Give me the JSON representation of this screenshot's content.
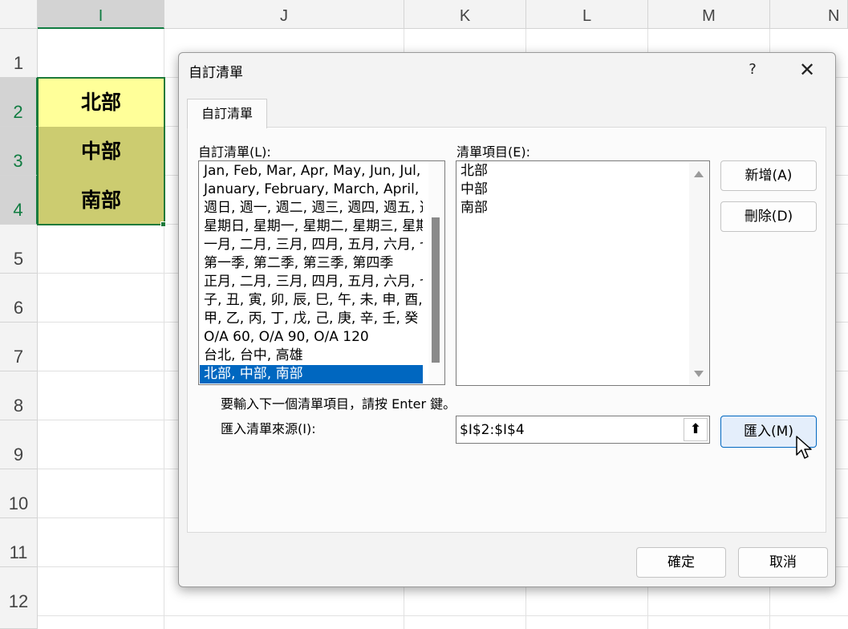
{
  "sheet": {
    "columns": [
      "I",
      "J",
      "K",
      "L",
      "M",
      "N"
    ],
    "rows": [
      "1",
      "2",
      "3",
      "4",
      "5",
      "6",
      "7",
      "8",
      "9",
      "10",
      "11",
      "12"
    ],
    "cells": [
      {
        "value": "北部",
        "fill": "#ffff99"
      },
      {
        "value": "中部",
        "fill": "#cccc70"
      },
      {
        "value": "南部",
        "fill": "#cccc70"
      }
    ]
  },
  "dialog": {
    "title": "自訂清單",
    "help_label": "?",
    "close_label": "✕",
    "tab_label": "自訂清單",
    "custom_lists_label": "自訂清單(L):",
    "custom_lists": [
      "Jan, Feb, Mar, Apr, May, Jun, Jul, A",
      "January, February, March, April, M",
      "週日, 週一, 週二, 週三, 週四, 週五, 週",
      "星期日, 星期一, 星期二, 星期三, 星期",
      "一月, 二月, 三月, 四月, 五月, 六月, 七",
      "第一季, 第二季, 第三季, 第四季",
      "正月, 二月, 三月, 四月, 五月, 六月, 七",
      "子, 丑, 寅, 卯, 辰, 巳, 午, 未, 申, 酉, 戌",
      "甲, 乙, 丙, 丁, 戊, 己, 庚, 辛, 壬, 癸",
      "O/A 60, O/A 90, O/A 120",
      "台北, 台中, 高雄",
      "北部, 中部, 南部"
    ],
    "selected_index": 11,
    "entries_label": "清單項目(E):",
    "entries": [
      "北部",
      "中部",
      "南部"
    ],
    "add_label": "新增(A)",
    "delete_label": "刪除(D)",
    "hint": "要輸入下一個清單項目，請按 Enter 鍵。",
    "import_source_label": "匯入清單來源(I):",
    "import_source_value": "$I$2:$I$4",
    "collapse_icon": "⬆",
    "import_label": "匯入(M)",
    "ok_label": "確定",
    "cancel_label": "取消"
  },
  "colors": {
    "accent": "#0067c0",
    "sheet_accent": "#107c41",
    "selection_border": "#1d7a3a"
  }
}
